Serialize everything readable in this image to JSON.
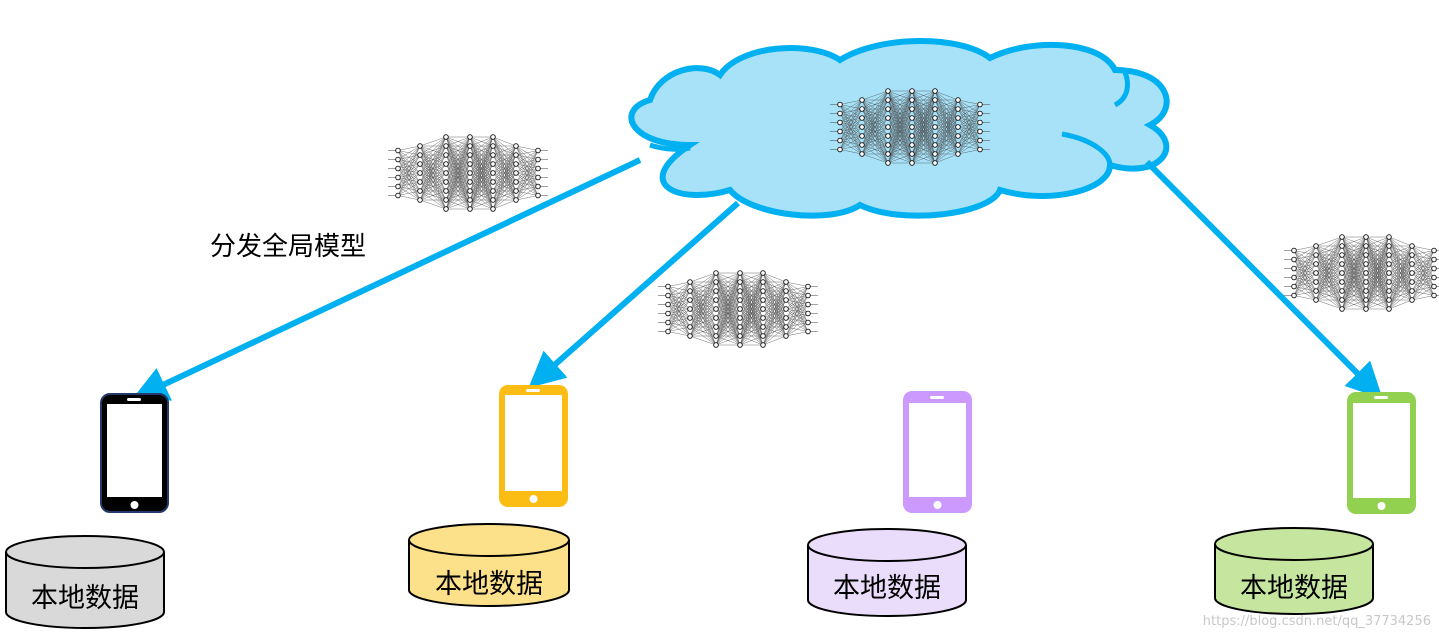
{
  "annotation": {
    "text": "分发全局模型"
  },
  "devices": [
    {
      "label": "本地数据",
      "phone_color": "#000000",
      "phone_frame": "#233a6a",
      "db_fill": "#d9d9d9"
    },
    {
      "label": "本地数据",
      "phone_color": "#fbbd14",
      "phone_frame": "#fbbd14",
      "db_fill": "#fde08a"
    },
    {
      "label": "本地数据",
      "phone_color": "#cc99ff",
      "phone_frame": "#cc99ff",
      "db_fill": "#eadcfb"
    },
    {
      "label": "本地数据",
      "phone_color": "#92d050",
      "phone_frame": "#92d050",
      "db_fill": "#c6e59f"
    }
  ],
  "cloud": {
    "fill": "#a8e2f8",
    "stroke": "#00b0f0"
  },
  "arrow_color": "#00b0f0",
  "watermark": "https://blog.csdn.net/qq_37734256"
}
